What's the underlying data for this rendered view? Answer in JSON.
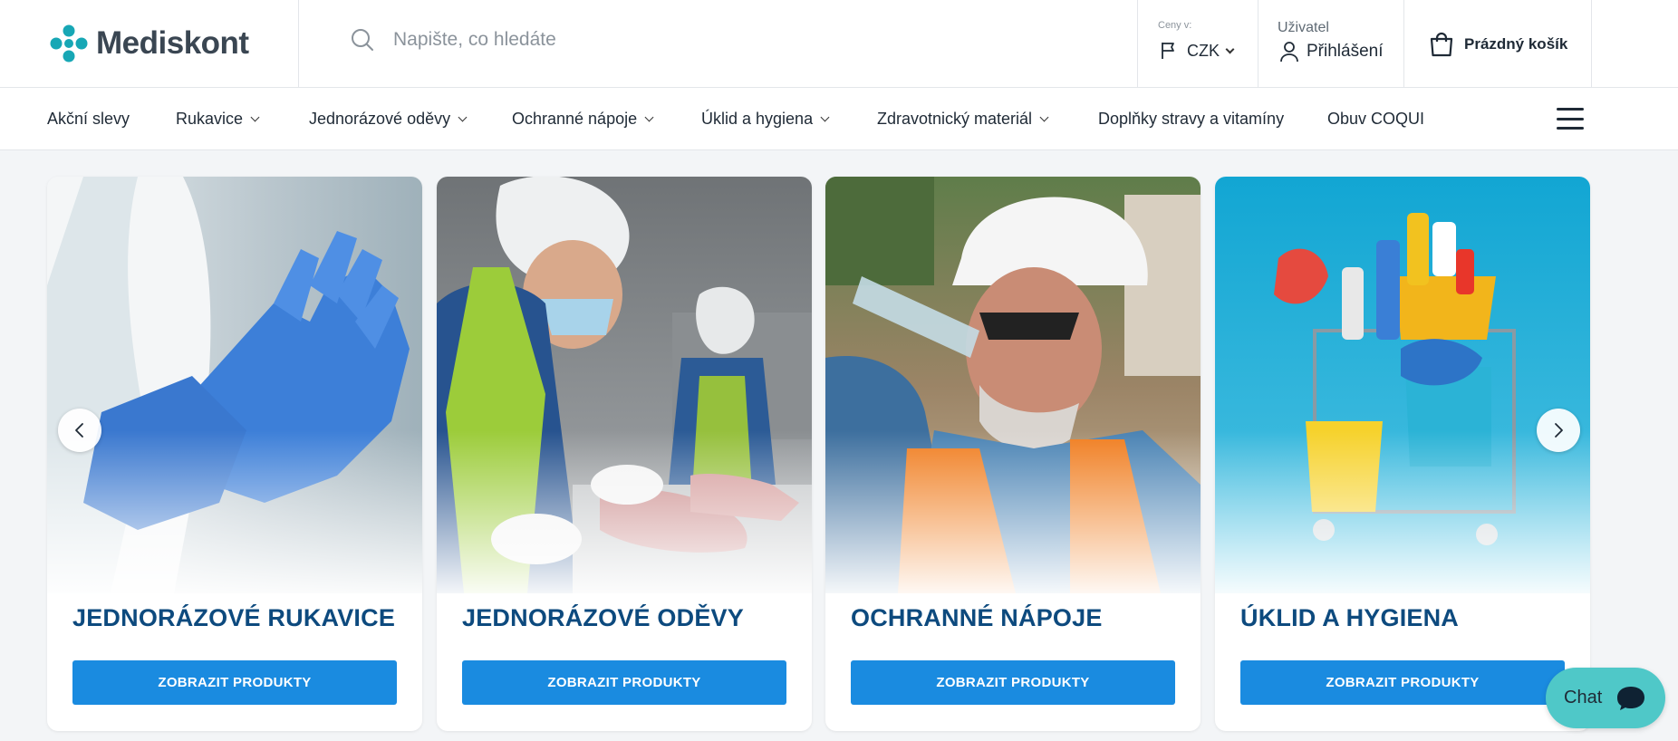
{
  "header": {
    "logo_text": "Mediskont",
    "search_placeholder": "Napište, co hledáte",
    "currency_label": "Ceny v:",
    "currency_value": "CZK",
    "user_label": "Uživatel",
    "login_label": "Přihlášení",
    "cart_label": "Prázdný košík"
  },
  "nav": {
    "items": [
      {
        "label": "Akční slevy"
      },
      {
        "label": "Rukavice"
      },
      {
        "label": "Jednorázové oděvy"
      },
      {
        "label": "Ochranné nápoje"
      },
      {
        "label": "Úklid a hygiena"
      },
      {
        "label": "Zdravotnický materiál"
      },
      {
        "label": "Doplňky stravy a vitamíny"
      },
      {
        "label": "Obuv COQUI"
      }
    ]
  },
  "cards": [
    {
      "title": "JEDNORÁZOVÉ RUKAVICE",
      "button": "ZOBRAZIT PRODUKTY",
      "image": "blue-nitrile-gloves"
    },
    {
      "title": "JEDNORÁZOVÉ ODĚVY",
      "button": "ZOBRAZIT PRODUKTY",
      "image": "food-worker-hairnet"
    },
    {
      "title": "OCHRANNÉ NÁPOJE",
      "button": "ZOBRAZIT PRODUKTY",
      "image": "worker-drinking-water"
    },
    {
      "title": "ÚKLID A HYGIENA",
      "button": "ZOBRAZIT PRODUKTY",
      "image": "cleaning-cart"
    }
  ],
  "chat": {
    "label": "Chat"
  },
  "colors": {
    "brand_teal": "#17a7b5",
    "title_blue": "#0d4a7e",
    "button_blue": "#1a8be0",
    "chat_teal": "#4fc8c8"
  }
}
